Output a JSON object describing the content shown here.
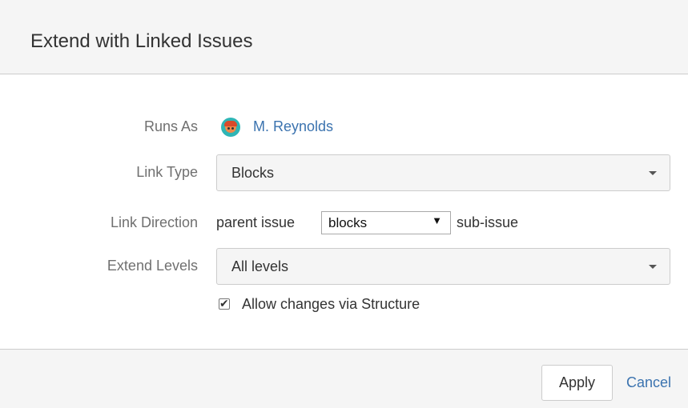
{
  "dialog": {
    "title": "Extend with Linked Issues"
  },
  "form": {
    "runs_as": {
      "label": "Runs As",
      "value": "M. Reynolds"
    },
    "link_type": {
      "label": "Link Type",
      "value": "Blocks"
    },
    "link_direction": {
      "label": "Link Direction",
      "prefix": "parent issue",
      "value": "blocks",
      "suffix": "sub-issue"
    },
    "extend_levels": {
      "label": "Extend Levels",
      "value": "All levels"
    },
    "allow_changes": {
      "label": "Allow changes via Structure",
      "checked": true
    }
  },
  "footer": {
    "apply_label": "Apply",
    "cancel_label": "Cancel"
  },
  "colors": {
    "link": "#3b73af",
    "header_bg": "#f5f5f5",
    "label": "#707070"
  },
  "icons": {
    "avatar": "user-avatar-icon",
    "caret": "chevron-down-icon",
    "check": "checkmark-icon"
  }
}
